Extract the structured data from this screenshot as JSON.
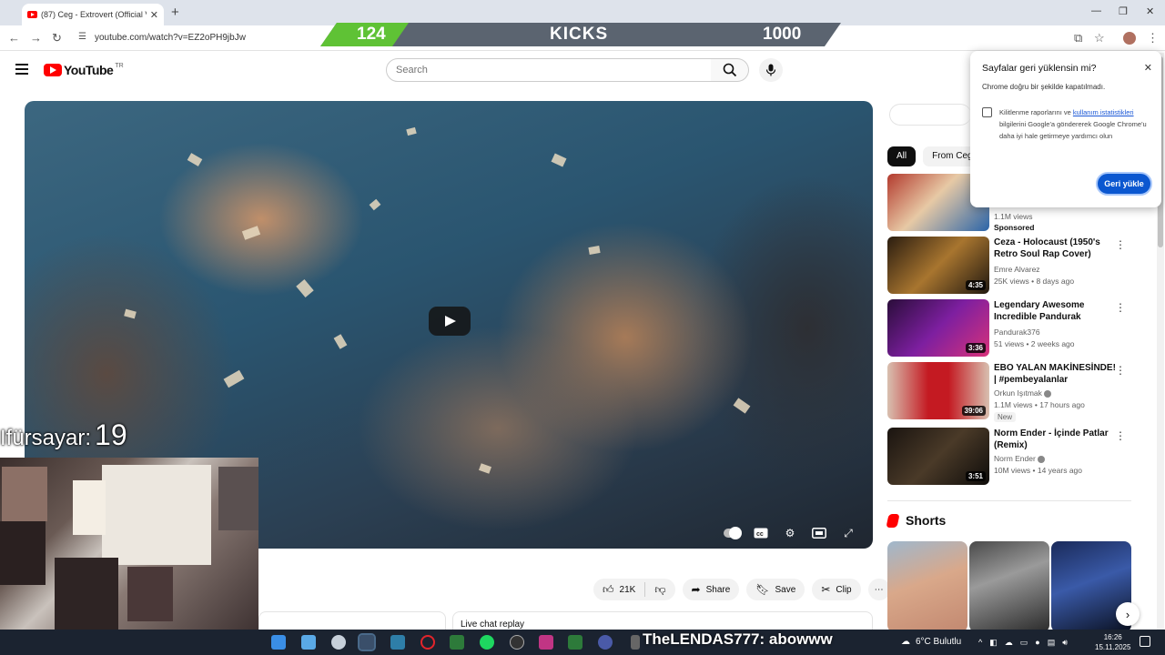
{
  "browser": {
    "tab_title": "(87) Ceg - Extrovert (Official Vi",
    "url": "youtube.com/watch?v=EZ2oPH9jbJw"
  },
  "kicks_banner": {
    "left_value": "124",
    "label": "KICKS",
    "right_value": "1000",
    "progress": 0.124,
    "fill_color": "#5fc235"
  },
  "youtube": {
    "logo_text": "YouTube",
    "country_code": "TR",
    "search_placeholder": "Search"
  },
  "video": {
    "player_state": "paused"
  },
  "stream_overlay": {
    "label": "Ifürsayar:",
    "value": "19"
  },
  "actions": {
    "likes": "21K",
    "share": "Share",
    "save": "Save",
    "clip": "Clip"
  },
  "live_chat_label": "Live chat replay",
  "sidebar": {
    "chips": [
      "All",
      "From Ceg"
    ],
    "recommendations": [
      {
        "title": "",
        "channel": "",
        "views": "1.1M views",
        "age": "",
        "duration": "",
        "badge": "Sponsored",
        "sponsored": true
      },
      {
        "title": "Ceza - Holocaust (1950's Retro Soul Rap Cover)",
        "channel": "Emre Alvarez",
        "views": "25K views",
        "age": "8 days ago",
        "duration": "4:35",
        "verified": false
      },
      {
        "title": "Legendary Awesome Incredible Pandurak",
        "channel": "Pandurak376",
        "views": "51 views",
        "age": "2 weeks ago",
        "duration": "3:36",
        "verified": false
      },
      {
        "title": "EBO YALAN MAKİNESİNDE! | #pembeyalanlar",
        "channel": "Orkun Işıtmak",
        "views": "1.1M views",
        "age": "17 hours ago",
        "duration": "39:06",
        "verified": true,
        "badge": "New"
      },
      {
        "title": "Norm Ender - İçinde Patlar (Remix)",
        "channel": "Norm Ender",
        "views": "10M views",
        "age": "14 years ago",
        "duration": "3:51",
        "verified": true
      }
    ],
    "shorts_title": "Shorts"
  },
  "restore_dialog": {
    "title": "Sayfalar geri yüklensin mi?",
    "subtitle": "Chrome doğru bir şekilde kapatılmadı.",
    "body_pre": "Kilitlenme raporlarını ve ",
    "body_link": "kullanım istatistikleri",
    "body_post": " bilgilerini Google'a göndererek Google Chrome'u daha iyi hale getirmeye yardımcı olun",
    "button": "Geri yükle"
  },
  "taskbar": {
    "chat_overlay": "TheLENDAS777: abowww",
    "weather": "6°C  Bulutlu",
    "time": "16:26",
    "date": "15.11.2025"
  },
  "colors": {
    "accent_red": "#ff0000",
    "dialog_button": "#0b57d0",
    "taskbar": "#1b2330"
  }
}
